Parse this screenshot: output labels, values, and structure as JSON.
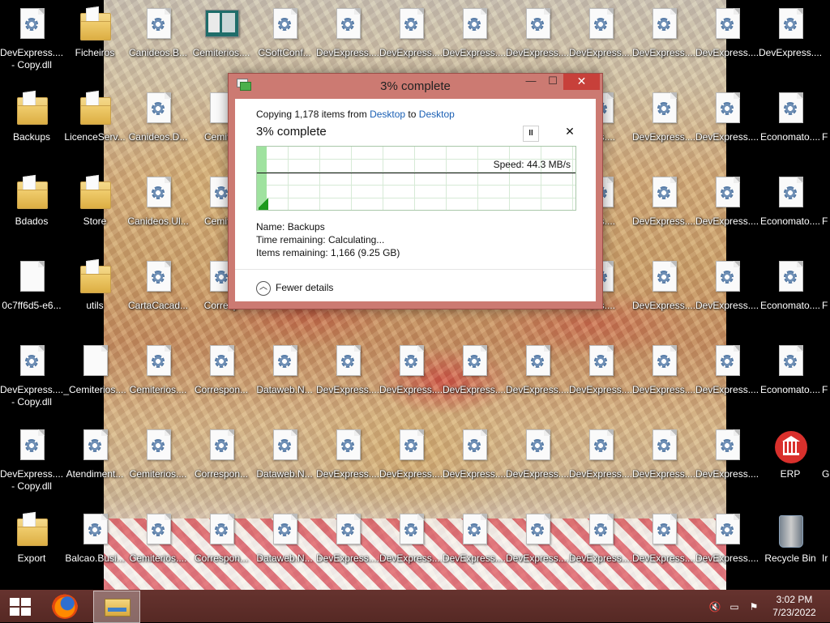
{
  "desktop_icons": [
    {
      "label": "DevExpress....\n- Copy.dll",
      "type": "dll"
    },
    {
      "label": "Ficheiros",
      "type": "folder"
    },
    {
      "label": "Canideos.B...",
      "type": "dll"
    },
    {
      "label": "Cemiterios....",
      "type": "screenshot"
    },
    {
      "label": "CSoftConf...",
      "type": "dll"
    },
    {
      "label": "DevExpress....",
      "type": "dll"
    },
    {
      "label": "DevExpress....",
      "type": "dll"
    },
    {
      "label": "DevExpress....",
      "type": "dll"
    },
    {
      "label": "DevExpress....",
      "type": "dll"
    },
    {
      "label": "DevExpress....",
      "type": "dll"
    },
    {
      "label": "DevExpress....",
      "type": "dll"
    },
    {
      "label": "DevExpress....",
      "type": "dll"
    },
    {
      "label": "DevExpress....",
      "type": "dll"
    },
    {
      "label": "Backups",
      "type": "folder"
    },
    {
      "label": "LicenceServ...",
      "type": "folder"
    },
    {
      "label": "Canideos.D...",
      "type": "dll"
    },
    {
      "label": "Cemiter",
      "type": "blank"
    },
    {
      "label": "ress....",
      "type": "dll"
    },
    {
      "label": "DevExpress....",
      "type": "dll"
    },
    {
      "label": "DevExpress....",
      "type": "dll"
    },
    {
      "label": "Economato....",
      "type": "dll"
    },
    {
      "label": "Bdados",
      "type": "folder"
    },
    {
      "label": "Store",
      "type": "folder"
    },
    {
      "label": "Canideos.Ul...",
      "type": "dll"
    },
    {
      "label": "Cemiter",
      "type": "dll"
    },
    {
      "label": "ress....",
      "type": "dll"
    },
    {
      "label": "DevExpress....",
      "type": "dll"
    },
    {
      "label": "DevExpress....",
      "type": "dll"
    },
    {
      "label": "Economato....",
      "type": "dll"
    },
    {
      "label": "0c7ff6d5-e6...",
      "type": "blank"
    },
    {
      "label": "utils",
      "type": "folder"
    },
    {
      "label": "CartaCacad...",
      "type": "dll"
    },
    {
      "label": "Corresp",
      "type": "dll"
    },
    {
      "label": "ress....",
      "type": "dll"
    },
    {
      "label": "DevExpress....",
      "type": "dll"
    },
    {
      "label": "DevExpress....",
      "type": "dll"
    },
    {
      "label": "Economato....",
      "type": "dll"
    },
    {
      "label": "DevExpress....\n- Copy.dll",
      "type": "dll"
    },
    {
      "label": "_Cemiterios....",
      "type": "blank"
    },
    {
      "label": "Cemiterios....",
      "type": "dll"
    },
    {
      "label": "Correspon...",
      "type": "dll"
    },
    {
      "label": "Dataweb.N...",
      "type": "dll"
    },
    {
      "label": "DevExpress....",
      "type": "dll"
    },
    {
      "label": "DevExpress....",
      "type": "dll"
    },
    {
      "label": "DevExpress....",
      "type": "dll"
    },
    {
      "label": "DevExpress....",
      "type": "dll"
    },
    {
      "label": "DevExpress....",
      "type": "dll"
    },
    {
      "label": "DevExpress....",
      "type": "dll"
    },
    {
      "label": "DevExpress....",
      "type": "dll"
    },
    {
      "label": "Economato....",
      "type": "dll"
    },
    {
      "label": "DevExpress....\n- Copy.dll",
      "type": "dll"
    },
    {
      "label": "Atendiment...",
      "type": "dll"
    },
    {
      "label": "Cemiterios....",
      "type": "dll"
    },
    {
      "label": "Correspon...",
      "type": "dll"
    },
    {
      "label": "Dataweb.N...",
      "type": "dll"
    },
    {
      "label": "DevExpress....",
      "type": "dll"
    },
    {
      "label": "DevExpress....",
      "type": "dll"
    },
    {
      "label": "DevExpress....",
      "type": "dll"
    },
    {
      "label": "DevExpress....",
      "type": "dll"
    },
    {
      "label": "DevExpress....",
      "type": "dll"
    },
    {
      "label": "DevExpress....",
      "type": "dll"
    },
    {
      "label": "DevExpress....",
      "type": "dll"
    },
    {
      "label": "ERP",
      "type": "erp"
    },
    {
      "label": "Export",
      "type": "folder"
    },
    {
      "label": "Balcao.Busi...",
      "type": "dll"
    },
    {
      "label": "Cemiterios....",
      "type": "dll"
    },
    {
      "label": "Correspon...",
      "type": "dll"
    },
    {
      "label": "Dataweb.N...",
      "type": "dll"
    },
    {
      "label": "DevExpress....",
      "type": "dll"
    },
    {
      "label": "DevExpress....",
      "type": "dll"
    },
    {
      "label": "DevExpress....",
      "type": "dll"
    },
    {
      "label": "DevExpress....",
      "type": "dll"
    },
    {
      "label": "DevExpress....",
      "type": "dll"
    },
    {
      "label": "DevExpress....",
      "type": "dll"
    },
    {
      "label": "DevExpress....",
      "type": "dll"
    },
    {
      "label": "Recycle Bin",
      "type": "bin"
    },
    {
      "label": "F",
      "type": "none"
    },
    {
      "label": "F",
      "type": "none"
    },
    {
      "label": "F",
      "type": "none"
    },
    {
      "label": "F",
      "type": "none"
    },
    {
      "label": "G",
      "type": "none"
    },
    {
      "label": "Ir",
      "type": "none"
    }
  ],
  "copy_dialog": {
    "title": "3% complete",
    "copying_prefix": "Copying 1,178 items from ",
    "source": "Desktop",
    "to_word": " to ",
    "destination": "Desktop",
    "percent_text": "3% complete",
    "progress_fraction": 0.03,
    "speed": "Speed: 44.3 MB/s",
    "name_label": "Name:",
    "name_value": "Backups",
    "time_label": "Time remaining:",
    "time_value": "Calculating...",
    "items_label": "Items remaining:",
    "items_value": "1,166 (9.25 GB)",
    "fewer_details": "Fewer details",
    "pause_glyph": "II",
    "cancel_glyph": "✕",
    "minimize_glyph": "—",
    "maximize_glyph": "☐",
    "close_glyph": "✕"
  },
  "taskbar": {
    "time": "3:02 PM",
    "date": "7/23/2022",
    "tray_icons": [
      "volume-muted-icon",
      "network-icon",
      "action-center-flag-icon"
    ]
  },
  "colors": {
    "window_frame": "#cc7a72",
    "close_button": "#c7403a",
    "progress_fill": "#9fe29f",
    "link": "#1a5fb4"
  }
}
